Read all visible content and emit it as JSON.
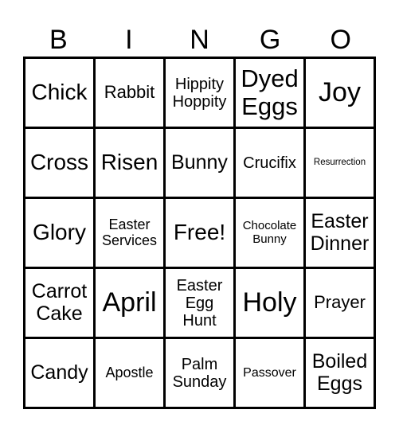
{
  "header": [
    "B",
    "I",
    "N",
    "G",
    "O"
  ],
  "cells": [
    [
      "Chick",
      "Rabbit",
      "Hippity Hoppity",
      "Dyed Eggs",
      "Joy"
    ],
    [
      "Cross",
      "Risen",
      "Bunny",
      "Crucifix",
      "Resurrection"
    ],
    [
      "Glory",
      "Easter Services",
      "Free!",
      "Chocolate Bunny",
      "Easter Dinner"
    ],
    [
      "Carrot Cake",
      "April",
      "Easter Egg Hunt",
      "Holy",
      "Prayer"
    ],
    [
      "Candy",
      "Apostle",
      "Palm Sunday",
      "Passover",
      "Boiled Eggs"
    ]
  ]
}
